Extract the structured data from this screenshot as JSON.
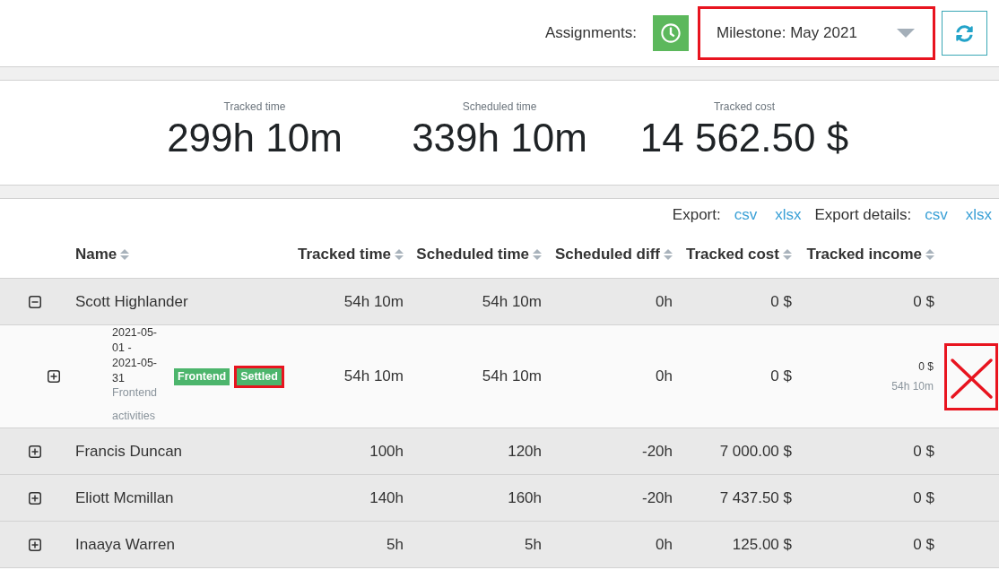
{
  "toolbar": {
    "label": "Assignments:",
    "milestone": {
      "value": "Milestone: May 2021",
      "highlighted": true
    }
  },
  "summary": [
    {
      "label": "Tracked time",
      "value": "299h 10m"
    },
    {
      "label": "Scheduled time",
      "value": "339h 10m"
    },
    {
      "label": "Tracked cost",
      "value": "14 562.50 $"
    }
  ],
  "export": [
    {
      "label": "Export:",
      "links": [
        "csv",
        "xlsx"
      ]
    },
    {
      "label": "Export details:",
      "links": [
        "csv",
        "xlsx"
      ]
    }
  ],
  "table": {
    "columns": [
      "Name",
      "Tracked time",
      "Scheduled time",
      "Scheduled diff",
      "Tracked cost",
      "Tracked income"
    ],
    "rows": [
      {
        "kind": "person",
        "expanded": true,
        "crossed_out": false,
        "cells": [
          "Scott Highlander",
          "54h 10m",
          "54h 10m",
          "0h",
          "0 $",
          "0 $"
        ]
      },
      {
        "kind": "period",
        "expanded": false,
        "crossed_out": true,
        "cells": [
          {
            "dates": "2021-05-01 - 2021-05-31",
            "description": "Frontend activities",
            "tags": [
              {
                "label": "Frontend",
                "highlighted": false
              },
              {
                "label": "Settled",
                "highlighted": true
              }
            ]
          },
          "54h 10m",
          "54h 10m",
          "0h",
          "0 $",
          {
            "amount": "0 $",
            "time": "54h 10m"
          }
        ]
      },
      {
        "kind": "person",
        "expanded": false,
        "crossed_out": false,
        "cells": [
          "Francis Duncan",
          "100h",
          "120h",
          "-20h",
          "7 000.00 $",
          "0 $"
        ]
      },
      {
        "kind": "person",
        "expanded": false,
        "crossed_out": false,
        "cells": [
          "Eliott Mcmillan",
          "140h",
          "160h",
          "-20h",
          "7 437.50 $",
          "0 $"
        ]
      },
      {
        "kind": "person",
        "expanded": false,
        "crossed_out": false,
        "cells": [
          "Inaaya Warren",
          "5h",
          "5h",
          "0h",
          "125.00 $",
          "0 $"
        ]
      }
    ]
  }
}
